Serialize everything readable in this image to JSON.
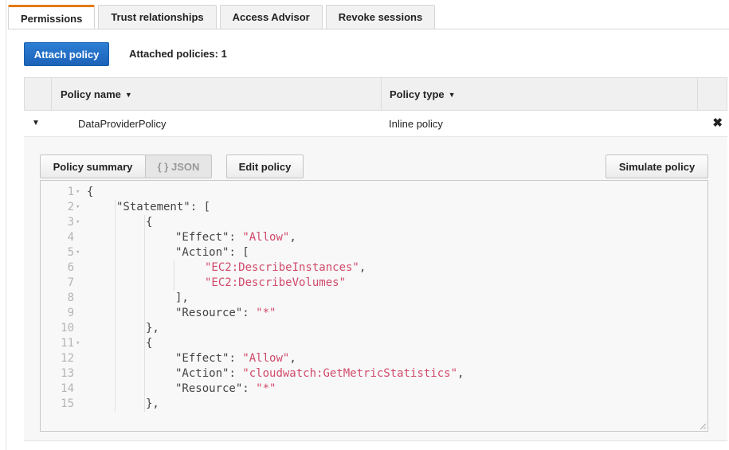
{
  "tabs": [
    "Permissions",
    "Trust relationships",
    "Access Advisor",
    "Revoke sessions"
  ],
  "toolbar": {
    "attach_label": "Attach policy",
    "attached_text": "Attached policies: 1"
  },
  "table": {
    "columns": [
      "Policy name",
      "Policy type"
    ],
    "row": {
      "name": "DataProviderPolicy",
      "type": "Inline policy"
    }
  },
  "detail": {
    "summary_label": "Policy summary",
    "json_label": "{ } JSON",
    "edit_label": "Edit policy",
    "simulate_label": "Simulate policy"
  },
  "editor": {
    "lines": [
      {
        "n": "1",
        "fold": true,
        "indent": 0,
        "key": "",
        "text": "{"
      },
      {
        "n": "2",
        "fold": true,
        "indent": 1,
        "key": "\"Statement\"",
        "text": ": ["
      },
      {
        "n": "3",
        "fold": true,
        "indent": 2,
        "key": "",
        "text": "{"
      },
      {
        "n": "4",
        "fold": false,
        "indent": 3,
        "key": "\"Effect\"",
        "text": ": ",
        "str": "\"Allow\"",
        "tail": ","
      },
      {
        "n": "5",
        "fold": true,
        "indent": 3,
        "key": "\"Action\"",
        "text": ": ["
      },
      {
        "n": "6",
        "fold": false,
        "indent": 4,
        "key": "",
        "text": "",
        "str": "\"EC2:DescribeInstances\"",
        "tail": ","
      },
      {
        "n": "7",
        "fold": false,
        "indent": 4,
        "key": "",
        "text": "",
        "str": "\"EC2:DescribeVolumes\"",
        "tail": ""
      },
      {
        "n": "8",
        "fold": false,
        "indent": 3,
        "key": "",
        "text": "],"
      },
      {
        "n": "9",
        "fold": false,
        "indent": 3,
        "key": "\"Resource\"",
        "text": ": ",
        "str": "\"*\"",
        "tail": ""
      },
      {
        "n": "10",
        "fold": false,
        "indent": 2,
        "key": "",
        "text": "},"
      },
      {
        "n": "11",
        "fold": true,
        "indent": 2,
        "key": "",
        "text": "{"
      },
      {
        "n": "12",
        "fold": false,
        "indent": 3,
        "key": "\"Effect\"",
        "text": ": ",
        "str": "\"Allow\"",
        "tail": ","
      },
      {
        "n": "13",
        "fold": false,
        "indent": 3,
        "key": "\"Action\"",
        "text": ": ",
        "str": "\"cloudwatch:GetMetricStatistics\"",
        "tail": ","
      },
      {
        "n": "14",
        "fold": false,
        "indent": 3,
        "key": "\"Resource\"",
        "text": ": ",
        "str": "\"*\"",
        "tail": ""
      },
      {
        "n": "15",
        "fold": false,
        "indent": 2,
        "key": "",
        "text": "},"
      }
    ]
  },
  "colors": {
    "accent_tab": "#e47911",
    "primary_button": "#1f6fc5",
    "string": "#d14a6a"
  }
}
